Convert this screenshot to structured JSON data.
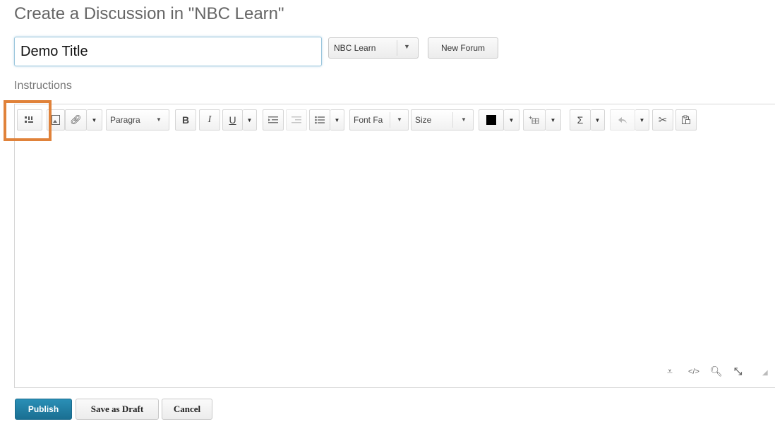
{
  "page": {
    "title": "Create a Discussion in \"NBC Learn\"",
    "title_input_value": "Demo Title",
    "forum_selected": "NBC Learn",
    "new_forum_label": "New Forum",
    "instructions_label": "Instructions"
  },
  "toolbar": {
    "paragraph_label": "Paragra",
    "font_family_label": "Font Fa",
    "size_label": "Size",
    "bold": "B",
    "italic": "I",
    "underline": "U",
    "sigma": "Σ",
    "text_color": "#000000",
    "icons": [
      "insert-stuff-icon",
      "insert-image-icon",
      "insert-link-icon",
      "bold-icon",
      "italic-icon",
      "underline-icon",
      "indent-icon",
      "outdent-icon",
      "bullet-list-icon",
      "text-color-icon",
      "insert-table-icon",
      "equation-icon",
      "undo-icon",
      "cut-icon",
      "paste-icon"
    ]
  },
  "editor_footer_icons": [
    "spellcheck-icon",
    "source-code-icon",
    "preview-icon",
    "fullscreen-icon",
    "resize-handle-icon"
  ],
  "actions": {
    "publish": "Publish",
    "save_draft": "Save as Draft",
    "cancel": "Cancel"
  },
  "colors": {
    "highlight": "#e0823a",
    "primary_button": "#1f7ea6"
  }
}
